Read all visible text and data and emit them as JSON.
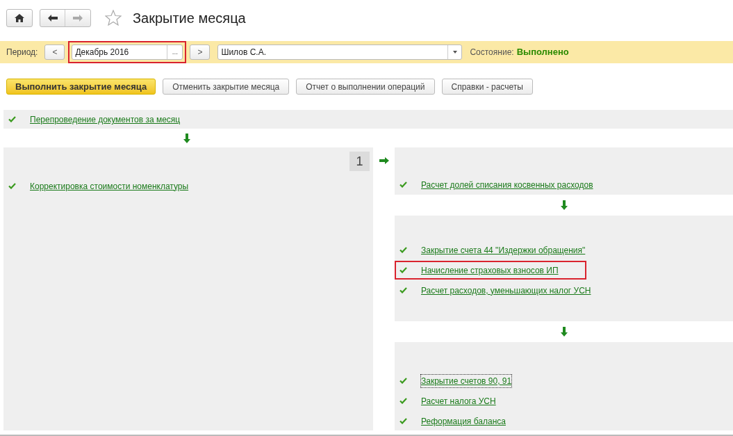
{
  "title": "Закрытие месяца",
  "favorite": false,
  "filter": {
    "period_label": "Период:",
    "prev": "<",
    "period": {
      "value": "Декабрь 2016",
      "highlighted": true
    },
    "choose": "...",
    "next": ">",
    "responsible": "Шилов С.А.",
    "state_label": "Состояние:",
    "state": "Выполнено"
  },
  "actions": [
    {
      "label": "Выполнить закрытие месяца",
      "primary": true
    },
    {
      "label": "Отменить закрытие месяца",
      "primary": false
    },
    {
      "label": "Отчет о выполнении операций",
      "primary": false
    },
    {
      "label": "Справки - расчеты",
      "primary": false
    }
  ],
  "first_step": {
    "operations": [
      {
        "label": "Перепроведение документов за месяц",
        "done": true,
        "highlighted": false,
        "focused": false
      }
    ]
  },
  "left_panel": {
    "badge": "1",
    "operations": [
      {
        "label": "Корректировка стоимости номенклатуры",
        "done": true,
        "highlighted": false,
        "focused": false
      }
    ]
  },
  "right_groups": [
    {
      "operations": [
        {
          "label": "Расчет долей списания косвенных расходов",
          "done": true,
          "highlighted": false,
          "focused": false
        }
      ]
    },
    {
      "operations": [
        {
          "label": "Закрытие счета 44 \"Издержки обращения\"",
          "done": true,
          "highlighted": false,
          "focused": false
        },
        {
          "label": "Начисление страховых взносов ИП",
          "done": true,
          "highlighted": true,
          "focused": false
        },
        {
          "label": "Расчет расходов, уменьшающих налог УСН",
          "done": true,
          "highlighted": false,
          "focused": false
        }
      ]
    },
    {
      "operations": [
        {
          "label": "Закрытие счетов 90, 91",
          "done": true,
          "highlighted": false,
          "focused": true
        },
        {
          "label": "Расчет налога УСН",
          "done": true,
          "highlighted": false,
          "focused": false
        },
        {
          "label": "Реформация баланса",
          "done": true,
          "highlighted": false,
          "focused": false
        }
      ]
    }
  ]
}
